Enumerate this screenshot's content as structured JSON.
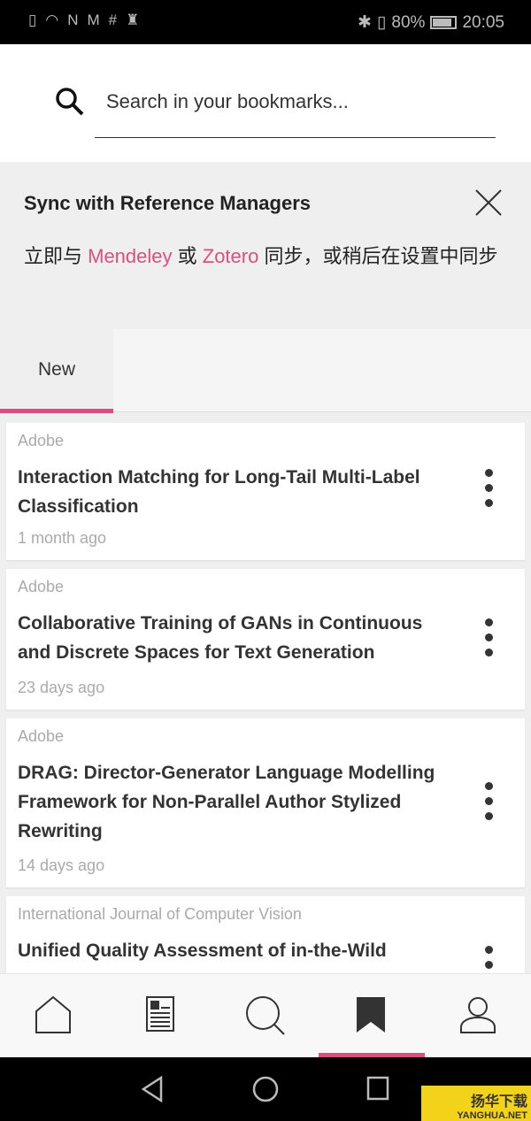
{
  "status_bar": {
    "icons": [
      "sim-alert-icon",
      "wifi-icon",
      "nfc-icon",
      "gmail-icon",
      "slack-icon",
      "keyhole-icon"
    ],
    "battery": "80%",
    "time": "20:05",
    "battery_level": 0.8
  },
  "search": {
    "placeholder": "Search in your bookmarks..."
  },
  "sync_banner": {
    "title": "Sync with Reference Managers",
    "text_before": "立即与 ",
    "mendeley": "Mendeley",
    "or": " 或 ",
    "zotero": "Zotero",
    "text_after": " 同步，或稍后在设置中同步"
  },
  "tabs": [
    {
      "label": "New",
      "active": true
    }
  ],
  "bookmarks": [
    {
      "source": "Adobe",
      "title": "Interaction Matching for Long-Tail Multi-Label Classification",
      "date": "1 month ago"
    },
    {
      "source": "Adobe",
      "title": "Collaborative Training of GANs in Continuous and Discrete Spaces for Text Generation",
      "date": "23 days ago"
    },
    {
      "source": "Adobe",
      "title": "DRAG: Director-Generator Language Modelling Framework for Non-Parallel Author Stylized Rewriting",
      "date": "14 days ago"
    },
    {
      "source": "International Journal of Computer Vision",
      "title": "Unified Quality Assessment of in-the-Wild",
      "date": ""
    }
  ],
  "bottom_nav": [
    {
      "icon": "home-icon"
    },
    {
      "icon": "feed-icon"
    },
    {
      "icon": "search-icon"
    },
    {
      "icon": "bookmark-icon",
      "active": true
    },
    {
      "icon": "profile-icon"
    }
  ],
  "watermark": {
    "text": "扬华下载",
    "sub": "YANGHUA.NET"
  },
  "colors": {
    "accent": "#db4f80"
  }
}
